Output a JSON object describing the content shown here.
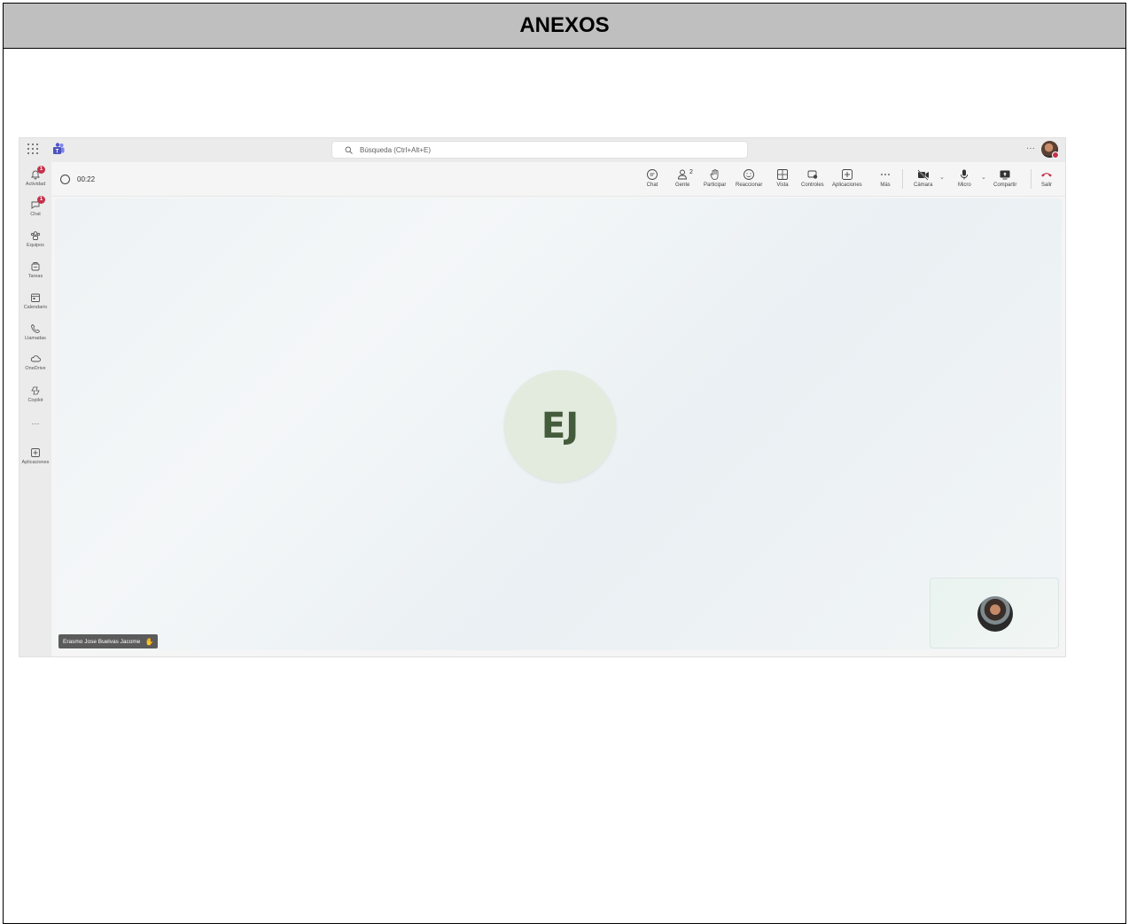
{
  "document": {
    "heading": "ANEXOS"
  },
  "teams": {
    "search_placeholder": "Búsqueda (Ctrl+Alt+E)",
    "more_label": "···",
    "rail": [
      {
        "id": "actividad",
        "label": "Actividad",
        "badge": "1",
        "icon": "bell-icon"
      },
      {
        "id": "chat",
        "label": "Chat",
        "badge": "1",
        "icon": "chat-icon"
      },
      {
        "id": "equipos",
        "label": "Equipos",
        "icon": "teams-icon"
      },
      {
        "id": "tareas",
        "label": "Tareas",
        "icon": "tasks-icon"
      },
      {
        "id": "calendario",
        "label": "Calendario",
        "icon": "calendar-icon"
      },
      {
        "id": "llamadas",
        "label": "Llamadas",
        "icon": "phone-icon"
      },
      {
        "id": "onedrive",
        "label": "OneDrive",
        "icon": "cloud-icon"
      },
      {
        "id": "copilot",
        "label": "Copilot",
        "icon": "copilot-icon"
      },
      {
        "id": "more",
        "label": "···",
        "icon": "more-icon"
      },
      {
        "id": "aplicaciones",
        "label": "Aplicaciones",
        "icon": "add-app-icon"
      }
    ],
    "meeting": {
      "timer": "00:22",
      "people_count": "2",
      "controls": {
        "chat": "Chat",
        "gente": "Gente",
        "participar": "Participar",
        "reaccionar": "Reaccionar",
        "vista": "Vista",
        "controles": "Controles",
        "aplicaciones": "Aplicaciones",
        "mas": "Más",
        "camara": "Cámara",
        "micro": "Micro",
        "compartir": "Compartir",
        "salir": "Salir"
      },
      "participant_initials": "EJ",
      "participant_name": "Erasmo Jose Buelvas Jacome",
      "hangup_color": "#c4314b"
    }
  }
}
